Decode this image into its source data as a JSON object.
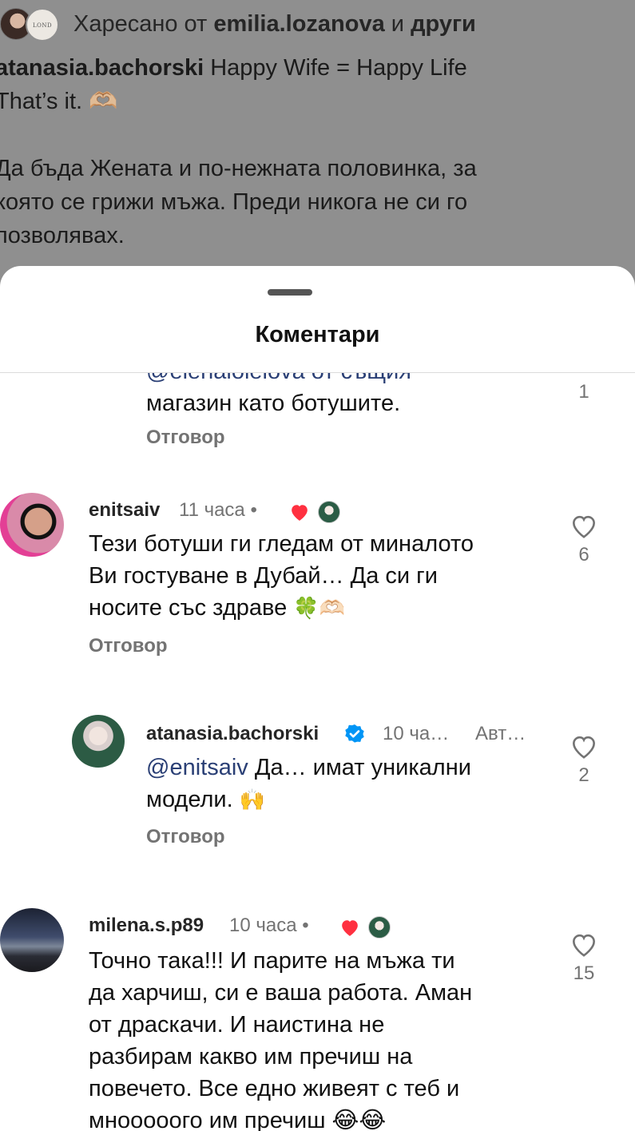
{
  "background_post": {
    "liked_prefix": "Харесано от ",
    "liked_user": "emilia.lozanova",
    "liked_and": " и ",
    "liked_others": "други",
    "avatar_logo_text": "LOND",
    "caption_user": "atanasia.bachorski",
    "caption_line1": " Happy Wife = Happy Life",
    "caption_line2": "That’s it. 🫶🏼",
    "caption_line3": "Да бъда Жената и по-нежната половинка, за",
    "caption_line4": "която се грижи мъжа. Преди никога не си го",
    "caption_line5": "позволявах."
  },
  "sheet": {
    "title": "Коментари"
  },
  "comments": [
    {
      "partial_line": "@elenalolelova от същия",
      "text_line2": "магазин като ботушите.",
      "reply_label": "Отговор",
      "likes": "1"
    },
    {
      "username": "enitsaiv",
      "time": "11 часа •",
      "text_line1": "Тези ботуши ги гледам от миналото",
      "text_line2": "Ви гостуване в Дубай… Да си ги",
      "text_line3": "носите със здраве",
      "text_emoji": "🍀🫶🏻",
      "reply_label": "Отговор",
      "likes": "6"
    },
    {
      "username": "atanasia.bachorski",
      "time": "10 ча…",
      "author_badge": "Авт…",
      "mention": "@enitsaiv",
      "text_line1": " Да… имат уникални",
      "text_line2": "модели.",
      "text_emoji": "🙌",
      "reply_label": "Отговор",
      "likes": "2"
    },
    {
      "username": "milena.s.p89",
      "time": "10 часа •",
      "text_line1": "Точно така!!! И парите на мъжа ти",
      "text_line2": "да харчиш, си е ваша работа. Аман",
      "text_line3": "от драскачи. И наистина не",
      "text_line4": "разбирам какво им пречиш на",
      "text_line5": "повечето. Все едно живеят с теб и",
      "text_line6": "мнооооого им пречиш 😂😂",
      "likes": "15"
    }
  ],
  "colors": {
    "like_red": "#ff3040",
    "verified_blue": "#0095f6",
    "secondary_text": "#737373",
    "mention_blue": "#2a3f75"
  },
  "icons": {
    "like": "heart-outline-icon",
    "creator_like": "heart-filled-icon",
    "verified": "verified-badge-icon"
  }
}
